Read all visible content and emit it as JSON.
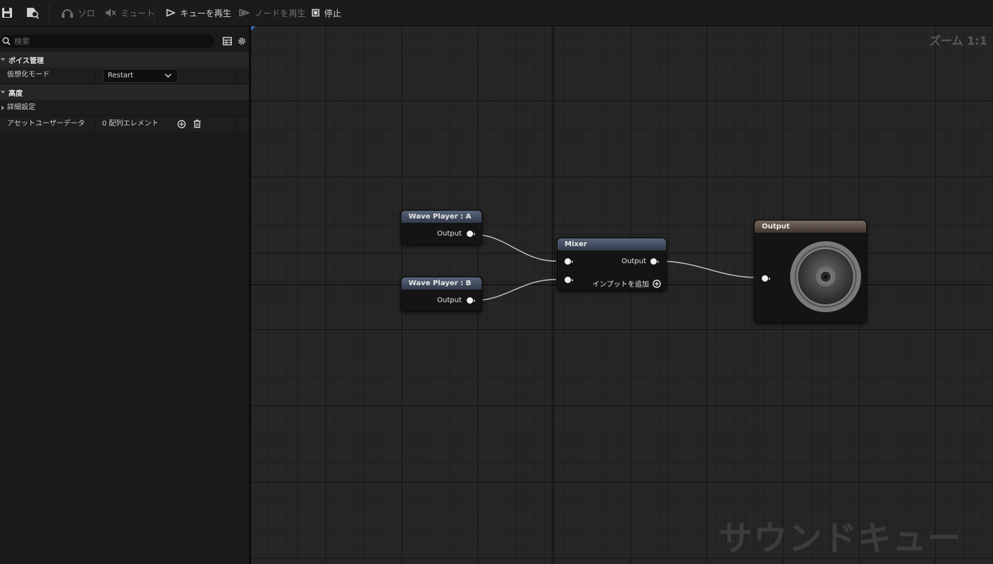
{
  "toolbar": {
    "solo": "ソロ",
    "mute": "ミュート",
    "play_cue": "キューを再生",
    "play_node": "ノードを再生",
    "stop": "停止"
  },
  "details": {
    "search_placeholder": "検索",
    "sections": {
      "voice_management": "ボイス管理",
      "advanced": "高度",
      "advanced_settings": "詳細設定"
    },
    "virtualization_mode": {
      "label": "仮想化モード",
      "value": "Restart"
    },
    "asset_user_data": {
      "label": "アセットユーザーデータ",
      "value": "0 配列エレメント"
    }
  },
  "graph": {
    "zoom": "ズーム 1:1",
    "watermark": "サウンドキュー",
    "nodes": {
      "wave_player_a": {
        "title": "Wave Player : A",
        "output": "Output"
      },
      "wave_player_b": {
        "title": "Wave Player : B",
        "output": "Output"
      },
      "mixer": {
        "title": "Mixer",
        "output": "Output",
        "add_input": "インプットを追加"
      },
      "output": {
        "title": "Output"
      }
    }
  },
  "icons": [
    "save-icon",
    "browse-asset-icon",
    "solo-icon",
    "mute-icon",
    "play-cue-icon",
    "play-node-icon",
    "stop-icon",
    "search-icon",
    "table-view-icon",
    "settings-icon",
    "add-element-icon",
    "delete-element-icon",
    "speaker-icon",
    "add-input-icon"
  ]
}
